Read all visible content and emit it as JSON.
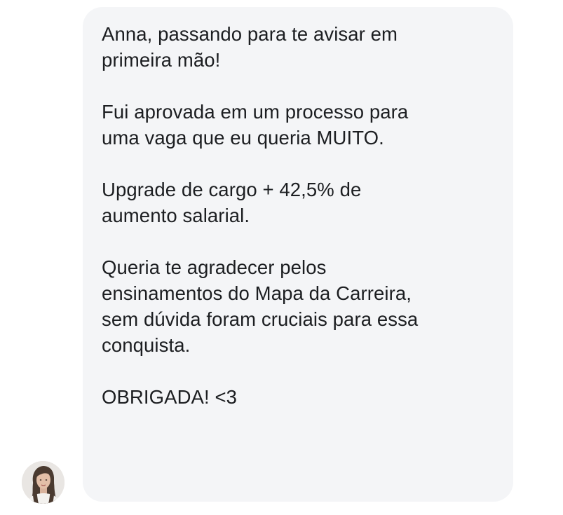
{
  "message": {
    "paragraphs": [
      "Anna, passando para te avisar em\nprimeira mão!",
      "Fui aprovada em um processo para\numa vaga que eu queria MUITO.",
      "Upgrade de cargo + 42,5% de\naumento salarial.",
      "Queria te agradecer pelos\nensinamentos do Mapa da Carreira,\nsem dúvida foram cruciais para essa\nconquista.",
      "OBRIGADA! <3"
    ]
  },
  "colors": {
    "bubble_background": "#f4f5f7",
    "text": "#1c1e21",
    "page_background": "#ffffff"
  },
  "icons": {
    "avatar": "user-avatar-photo"
  }
}
